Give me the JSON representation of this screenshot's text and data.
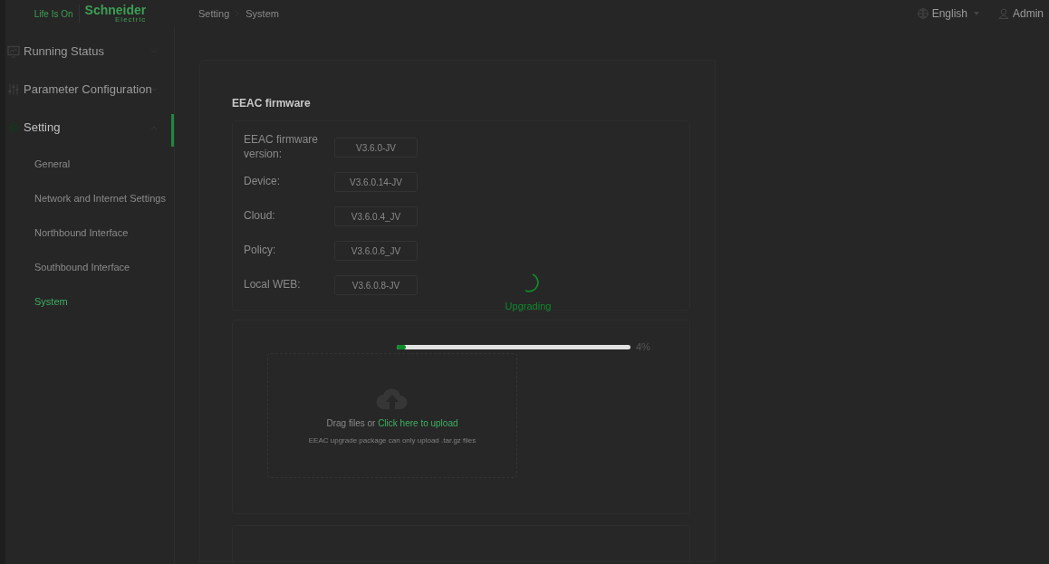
{
  "logo": {
    "tagline": "Life Is On",
    "brand": "Schneider",
    "brand_sub": "Electric"
  },
  "breadcrumb": [
    "Setting",
    "System"
  ],
  "header": {
    "language": "English",
    "user": "Admin"
  },
  "sidebar": {
    "items": [
      {
        "label": "Running Status",
        "expanded": false,
        "selected": false
      },
      {
        "label": "Parameter Configuration",
        "expanded": false,
        "selected": false
      },
      {
        "label": "Setting",
        "expanded": true,
        "selected": true,
        "children": [
          {
            "label": "General",
            "selected": false
          },
          {
            "label": "Network and Internet Settings",
            "selected": false
          },
          {
            "label": "Northbound Interface",
            "selected": false
          },
          {
            "label": "Southbound Interface",
            "selected": false
          },
          {
            "label": "System",
            "selected": true
          }
        ]
      }
    ]
  },
  "firmware": {
    "title": "EEAC firmware",
    "versions": [
      {
        "label": "EEAC firmware version:",
        "value": "V3.6.0-JV"
      },
      {
        "label": "Device:",
        "value": "V3.6.0.14-JV"
      },
      {
        "label": "Cloud:",
        "value": "V3.6.0.4_JV"
      },
      {
        "label": "Policy:",
        "value": "V3.6.0.6_JV"
      },
      {
        "label": "Local WEB:",
        "value": "V3.6.0.8-JV"
      }
    ]
  },
  "upload": {
    "prompt": "Drag files or",
    "link": "Click here to upload",
    "hint": "EEAC upgrade package can only upload .tar.gz files"
  },
  "progress": {
    "status": "Upgrading",
    "level": 0.04,
    "reading": "4%"
  }
}
